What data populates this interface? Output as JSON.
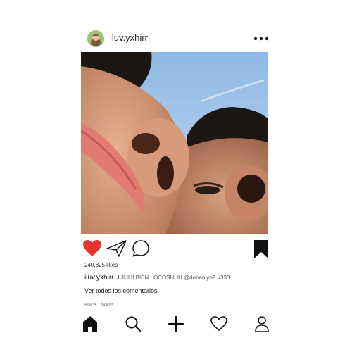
{
  "post": {
    "username": "iluv.yxhirr",
    "likes": "240,825 likes",
    "caption_user": "iluv.yxhirr",
    "caption_text": "JIJIJIJI BIEN LOCOSHHH @debaniyo2 <333",
    "view_comments": "Ver todos los comentarios",
    "time_ago": "Hace 7 horas."
  },
  "icons": {
    "more": "more-horizontal-icon",
    "like": "heart-filled-icon",
    "share": "paper-plane-icon",
    "comment": "comment-bubble-icon",
    "save": "bookmark-filled-icon",
    "nav": [
      "home-icon",
      "search-icon",
      "plus-icon",
      "heart-outline-icon",
      "profile-icon"
    ]
  },
  "colors": {
    "like": "#e8322e",
    "ink": "#111111",
    "sky": "#a8c8ea"
  }
}
